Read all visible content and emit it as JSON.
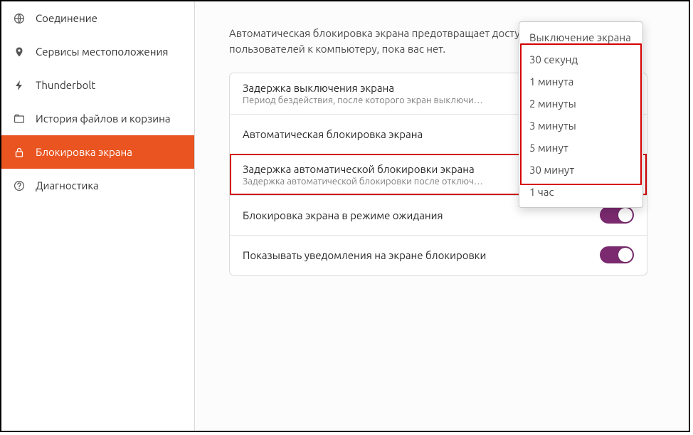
{
  "sidebar": {
    "items": [
      {
        "label": "Соединение"
      },
      {
        "label": "Сервисы местоположения"
      },
      {
        "label": "Thunderbolt"
      },
      {
        "label": "История файлов и корзина"
      },
      {
        "label": "Блокировка экрана"
      },
      {
        "label": "Диагностика"
      }
    ]
  },
  "main": {
    "intro": "Автоматическая блокировка экрана предотвращает доступ других пользователей к компьютеру, пока вас нет.",
    "rows": {
      "blank_delay": {
        "title": "Задержка выключения экрана",
        "sub": "Период бездействия, после которого экран выключится."
      },
      "auto_lock": {
        "title": "Автоматическая блокировка экрана"
      },
      "lock_delay": {
        "title": "Задержка автоматической блокировки экрана",
        "sub": "Задержка автоматической блокировки после отключения э…"
      },
      "suspend_lock": {
        "title": "Блокировка экрана в режиме ожидания"
      },
      "notif_lock": {
        "title": "Показывать уведомления на экране блокировки"
      }
    }
  },
  "popup": {
    "items": [
      "Выключение экрана",
      "30 секунд",
      "1 минута",
      "2 минуты",
      "3 минуты",
      "5 минут",
      "30 минут",
      "1 час"
    ]
  }
}
